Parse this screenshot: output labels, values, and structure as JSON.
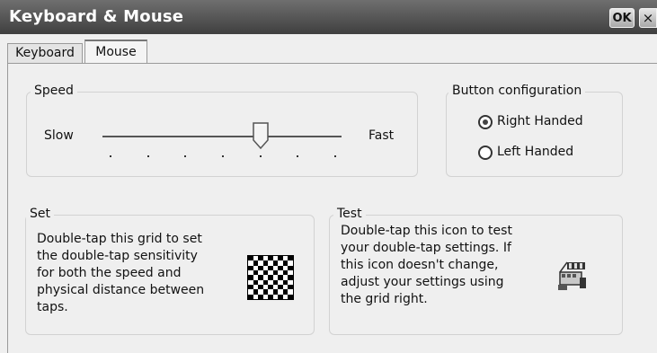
{
  "window": {
    "title": "Keyboard & Mouse",
    "ok_label": "OK",
    "close_label": "×"
  },
  "tabs": [
    {
      "label": "Keyboard",
      "selected": false
    },
    {
      "label": "Mouse",
      "selected": true
    }
  ],
  "speed": {
    "legend": "Speed",
    "slow_label": "Slow",
    "fast_label": "Fast",
    "ticks": 7,
    "position": 5
  },
  "button_config": {
    "legend": "Button configuration",
    "options": [
      {
        "label": "Right Handed",
        "selected": true
      },
      {
        "label": "Left Handed",
        "selected": false
      }
    ]
  },
  "set": {
    "legend": "Set",
    "text": [
      "Double-tap this grid to set",
      "the double-tap sensitivity",
      "for both the speed and",
      "physical distance between",
      "taps."
    ],
    "grid_icon": "checkerboard-grid"
  },
  "test": {
    "legend": "Test",
    "text": [
      "Double-tap this icon to test",
      "your double-tap settings. If",
      "this icon doesn't change,",
      "adjust your settings using",
      "the grid right."
    ],
    "icon": "clapper-icon"
  }
}
